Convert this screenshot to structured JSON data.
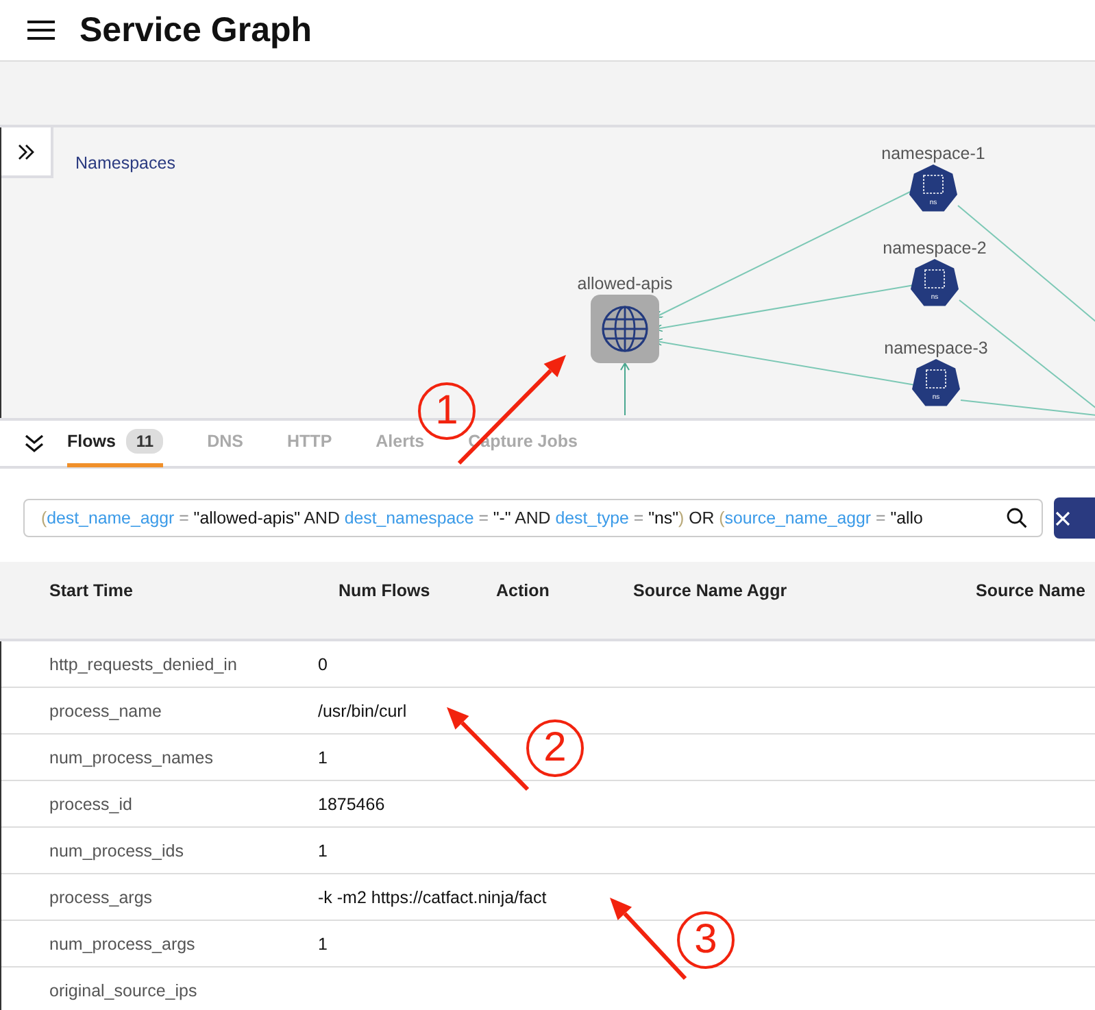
{
  "header": {
    "title": "Service Graph"
  },
  "graph": {
    "panel_label": "Namespaces",
    "nodes": [
      {
        "kind": "service",
        "label": "allowed-apis"
      },
      {
        "kind": "namespace",
        "label": "namespace-1",
        "badge": "ns"
      },
      {
        "kind": "namespace",
        "label": "namespace-2",
        "badge": "ns"
      },
      {
        "kind": "namespace",
        "label": "namespace-3",
        "badge": "ns"
      }
    ]
  },
  "tabs": [
    {
      "label": "Flows",
      "count": "11",
      "selected": true
    },
    {
      "label": "DNS",
      "selected": false
    },
    {
      "label": "HTTP",
      "selected": false
    },
    {
      "label": "Alerts",
      "selected": false
    },
    {
      "label": "Capture Jobs",
      "selected": false
    }
  ],
  "query": {
    "tokens": [
      {
        "kind": "paren",
        "text": "("
      },
      {
        "kind": "field",
        "text": "dest_name_aggr"
      },
      {
        "kind": "op",
        "text": "="
      },
      {
        "kind": "value",
        "text": "\"allowed-apis\""
      },
      {
        "kind": "keyword",
        "text": "AND"
      },
      {
        "kind": "field",
        "text": "dest_namespace"
      },
      {
        "kind": "op",
        "text": "="
      },
      {
        "kind": "value",
        "text": "\"-\""
      },
      {
        "kind": "keyword",
        "text": "AND"
      },
      {
        "kind": "field",
        "text": "dest_type"
      },
      {
        "kind": "op",
        "text": "="
      },
      {
        "kind": "value",
        "text": "\"ns\""
      },
      {
        "kind": "paren",
        "text": ")"
      },
      {
        "kind": "keyword",
        "text": "OR"
      },
      {
        "kind": "paren",
        "text": "("
      },
      {
        "kind": "field",
        "text": "source_name_aggr"
      },
      {
        "kind": "op",
        "text": "="
      },
      {
        "kind": "value",
        "text": "\"allo"
      }
    ]
  },
  "table": {
    "columns": [
      "Start Time",
      "Num Flows",
      "Action",
      "Source Name Aggr",
      "Source Name"
    ],
    "rows": [
      {
        "key": "http_requests_denied_in",
        "value": "0"
      },
      {
        "key": "process_name",
        "value": "/usr/bin/curl"
      },
      {
        "key": "num_process_names",
        "value": "1"
      },
      {
        "key": "process_id",
        "value": "1875466"
      },
      {
        "key": "num_process_ids",
        "value": "1"
      },
      {
        "key": "process_args",
        "value": "-k -m2 https://catfact.ninja/fact"
      },
      {
        "key": "num_process_args",
        "value": "1"
      },
      {
        "key": "original_source_ips"
      }
    ]
  },
  "annotations": [
    {
      "label": "1"
    },
    {
      "label": "2"
    },
    {
      "label": "3"
    }
  ]
}
